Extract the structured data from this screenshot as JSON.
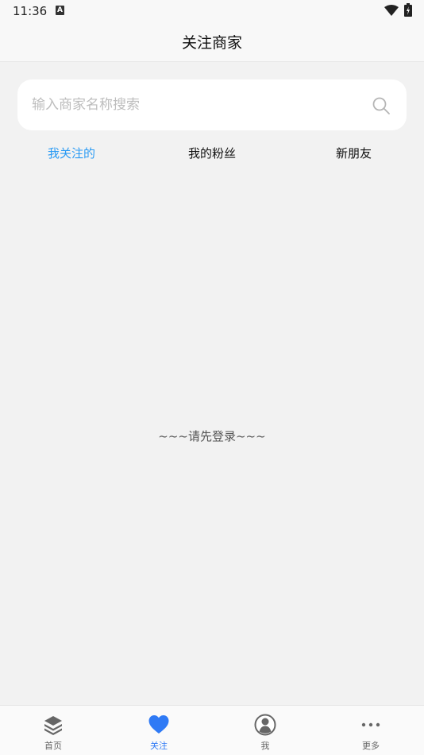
{
  "status_bar": {
    "time": "11:36",
    "notification_glyph": "A"
  },
  "header": {
    "title": "关注商家"
  },
  "search": {
    "placeholder": "输入商家名称搜索",
    "value": ""
  },
  "tabs": [
    {
      "label": "我关注的",
      "active": true
    },
    {
      "label": "我的粉丝",
      "active": false
    },
    {
      "label": "新朋友",
      "active": false
    }
  ],
  "empty_state": {
    "message": "~~~请先登录~~~"
  },
  "bottom_nav": {
    "items": [
      {
        "label": "首页",
        "icon": "layers-icon",
        "active": false
      },
      {
        "label": "关注",
        "icon": "heart-icon",
        "active": true
      },
      {
        "label": "我",
        "icon": "user-icon",
        "active": false
      },
      {
        "label": "更多",
        "icon": "more-dots-icon",
        "active": false
      }
    ]
  },
  "colors": {
    "accent_tab": "#2b9bf4",
    "accent_nav": "#2f7af5",
    "background": "#f2f2f2"
  }
}
